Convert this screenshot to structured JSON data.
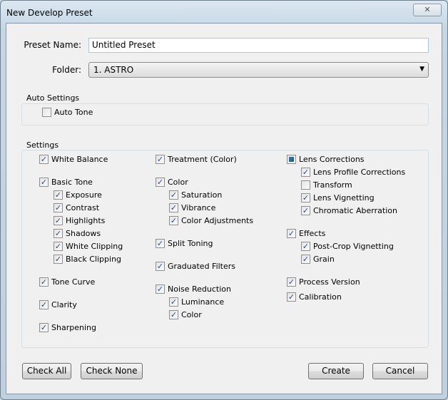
{
  "window": {
    "title": "New Develop Preset",
    "close": "✕"
  },
  "form": {
    "preset_name_label": "Preset Name:",
    "preset_name_value": "Untitled Preset",
    "folder_label": "Folder:",
    "folder_value": "1. ASTRO"
  },
  "auto_settings": {
    "title": "Auto Settings",
    "auto_tone": {
      "label": "Auto Tone",
      "checked": false
    }
  },
  "settings": {
    "title": "Settings",
    "items": [
      {
        "label": "White Balance",
        "state": "checked"
      },
      {
        "label": "Basic Tone",
        "state": "checked"
      },
      {
        "label": "Exposure",
        "state": "checked"
      },
      {
        "label": "Contrast",
        "state": "checked"
      },
      {
        "label": "Highlights",
        "state": "checked"
      },
      {
        "label": "Shadows",
        "state": "checked"
      },
      {
        "label": "White Clipping",
        "state": "checked"
      },
      {
        "label": "Black Clipping",
        "state": "checked"
      },
      {
        "label": "Tone Curve",
        "state": "checked"
      },
      {
        "label": "Clarity",
        "state": "checked"
      },
      {
        "label": "Sharpening",
        "state": "checked"
      },
      {
        "label": "Treatment (Color)",
        "state": "checked"
      },
      {
        "label": "Color",
        "state": "checked"
      },
      {
        "label": "Saturation",
        "state": "checked"
      },
      {
        "label": "Vibrance",
        "state": "checked"
      },
      {
        "label": "Color Adjustments",
        "state": "checked"
      },
      {
        "label": "Split Toning",
        "state": "checked"
      },
      {
        "label": "Graduated Filters",
        "state": "checked"
      },
      {
        "label": "Noise Reduction",
        "state": "checked"
      },
      {
        "label": "Luminance",
        "state": "checked"
      },
      {
        "label": "Color",
        "state": "checked"
      },
      {
        "label": "Lens Corrections",
        "state": "indeterminate"
      },
      {
        "label": "Lens Profile Corrections",
        "state": "checked"
      },
      {
        "label": "Transform",
        "state": "unchecked"
      },
      {
        "label": "Lens Vignetting",
        "state": "checked"
      },
      {
        "label": "Chromatic Aberration",
        "state": "checked"
      },
      {
        "label": "Effects",
        "state": "checked"
      },
      {
        "label": "Post-Crop Vignetting",
        "state": "checked"
      },
      {
        "label": "Grain",
        "state": "checked"
      },
      {
        "label": "Process Version",
        "state": "checked"
      },
      {
        "label": "Calibration",
        "state": "checked"
      }
    ]
  },
  "buttons": {
    "check_all": "Check All",
    "check_none": "Check None",
    "create": "Create",
    "cancel": "Cancel"
  }
}
